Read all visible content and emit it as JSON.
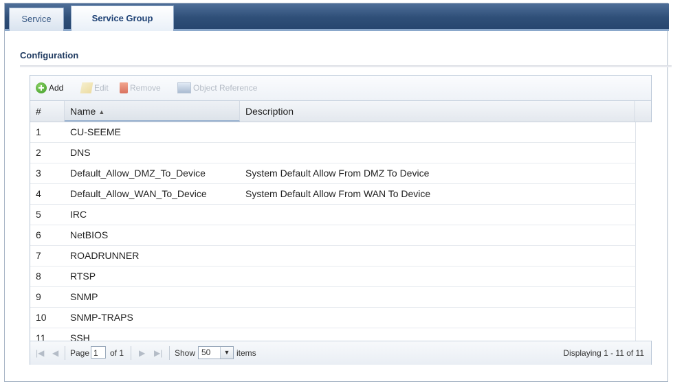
{
  "tabs": [
    {
      "label": "Service",
      "active": false
    },
    {
      "label": "Service Group",
      "active": true
    }
  ],
  "section": {
    "title": "Configuration"
  },
  "toolbar": {
    "add": "Add",
    "edit": "Edit",
    "remove": "Remove",
    "object_reference": "Object Reference"
  },
  "table": {
    "columns": [
      "#",
      "Name",
      "Description"
    ],
    "sort_indicator": "▲",
    "rows": [
      {
        "num": "1",
        "name": "CU-SEEME",
        "description": ""
      },
      {
        "num": "2",
        "name": "DNS",
        "description": ""
      },
      {
        "num": "3",
        "name": "Default_Allow_DMZ_To_Device",
        "description": "System Default Allow From DMZ To Device"
      },
      {
        "num": "4",
        "name": "Default_Allow_WAN_To_Device",
        "description": "System Default Allow From WAN To Device"
      },
      {
        "num": "5",
        "name": "IRC",
        "description": ""
      },
      {
        "num": "6",
        "name": "NetBIOS",
        "description": ""
      },
      {
        "num": "7",
        "name": "ROADRUNNER",
        "description": ""
      },
      {
        "num": "8",
        "name": "RTSP",
        "description": ""
      },
      {
        "num": "9",
        "name": "SNMP",
        "description": ""
      },
      {
        "num": "10",
        "name": "SNMP-TRAPS",
        "description": ""
      },
      {
        "num": "11",
        "name": "SSH",
        "description": ""
      }
    ]
  },
  "pager": {
    "page_label": "Page",
    "page_value": "1",
    "of_label": "of 1",
    "show_label": "Show",
    "show_value": "50",
    "items_label": "items",
    "displaying": "Displaying 1 - 11 of 11"
  }
}
